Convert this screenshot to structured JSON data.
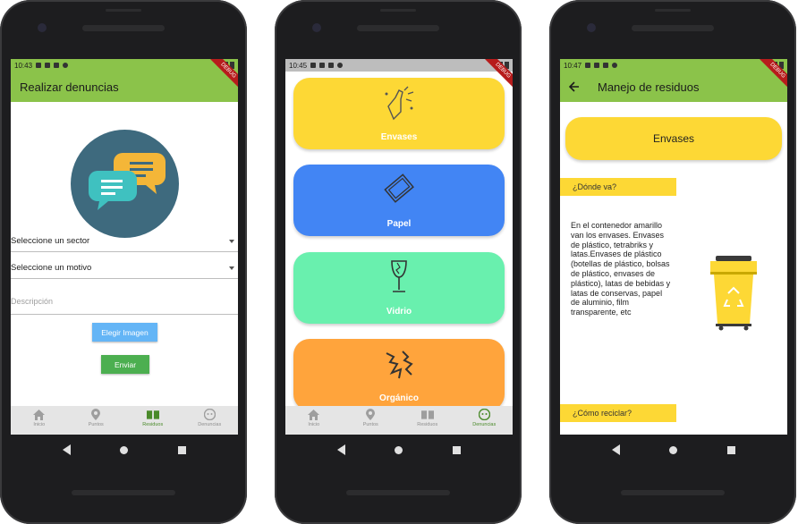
{
  "status": {
    "time1": "10:43",
    "time2": "10:45",
    "time3": "10:47",
    "debug_banner": "DEBUG"
  },
  "screen1": {
    "appbar_title": "Realizar denuncias",
    "sector_dropdown": "Seleccione un sector",
    "motivo_dropdown": "Seleccione un motivo",
    "description_placeholder": "Descripción",
    "choose_image_button": "Elegir Imagen",
    "send_button": "Enviar"
  },
  "screen2": {
    "cards": [
      {
        "label": "Envases",
        "color": "#fdd835",
        "icon": "bottle-icon"
      },
      {
        "label": "Papel",
        "color": "#4285f4",
        "icon": "paper-icon"
      },
      {
        "label": "Vidrio",
        "color": "#69f0ae",
        "icon": "glass-icon"
      },
      {
        "label": "Orgánico",
        "color": "#ffa43c",
        "icon": "organic-icon"
      }
    ]
  },
  "screen3": {
    "appbar_title": "Manejo de residuos",
    "title_card": "Envases",
    "where_label": "¿Dónde va?",
    "body": "En el contenedor amarillo van los envases. Envases de plástico, tetrabriks y latas.Envases de plástico (botellas de plástico, bolsas de plástico, envases de plástico), latas de bebidas y latas de conservas, papel de aluminio, film transparente, etc",
    "recycle_label": "¿Cómo reciclar?"
  },
  "bottom_nav": [
    {
      "label": "Inicio",
      "icon": "home-icon"
    },
    {
      "label": "Puntos",
      "icon": "location-icon"
    },
    {
      "label": "Residuos",
      "icon": "book-icon"
    },
    {
      "label": "Denuncias",
      "icon": "face-icon"
    }
  ],
  "colors": {
    "appbar": "#8bc34a",
    "yellow": "#fdd835",
    "blue": "#4285f4",
    "green": "#69f0ae",
    "orange": "#ffa43c",
    "button_blue": "#64b5f6",
    "button_green": "#4caf50"
  }
}
